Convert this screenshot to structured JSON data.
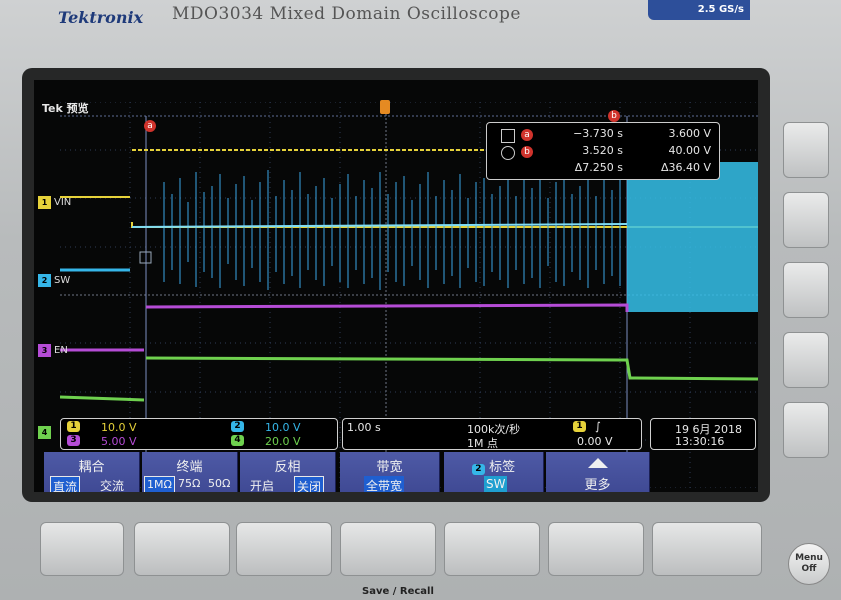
{
  "header": {
    "brand": "Tektronix",
    "model": "MDO3034 Mixed Domain Oscilloscope",
    "spec": "2.5 GS/s"
  },
  "screen": {
    "mode_label": "Tek 预览",
    "channels": [
      {
        "num": "1",
        "label": "VIN",
        "color": "#e6d23a"
      },
      {
        "num": "2",
        "label": "SW",
        "color": "#35b6e8"
      },
      {
        "num": "3",
        "label": "EN",
        "color": "#b54cd6"
      },
      {
        "num": "4",
        "label": "",
        "color": "#6fd14f"
      }
    ],
    "cursor_readout": {
      "a": {
        "symbol": "square",
        "tag": "a",
        "time": "−3.730 s",
        "voltage": "3.600 V"
      },
      "b": {
        "symbol": "circle",
        "tag": "b",
        "time": "3.520 s",
        "voltage": "40.00 V"
      },
      "delta": {
        "time": "Δ7.250 s",
        "voltage": "Δ36.40 V"
      }
    },
    "markers": {
      "a": "a",
      "b": "b"
    }
  },
  "status": {
    "scales": [
      {
        "num": "1",
        "value": "10.0 V",
        "color": "#e6d23a"
      },
      {
        "num": "2",
        "value": "10.0 V",
        "color": "#35b6e8"
      },
      {
        "num": "3",
        "value": "5.00 V",
        "color": "#b54cd6"
      },
      {
        "num": "4",
        "value": "20.0 V",
        "color": "#6fd14f"
      }
    ],
    "timebase": "1.00 s",
    "sample_rate": "100k次/秒",
    "record_length": "1M 点",
    "trigger_channel": "1",
    "trigger_level": "0.00 V",
    "date": "19 6月 2018",
    "time": "13:30:16"
  },
  "menu": {
    "coupling": {
      "title": "耦合",
      "options": [
        "直流",
        "交流"
      ],
      "selected": "直流"
    },
    "termination": {
      "title": "终端",
      "options": [
        "1MΩ",
        "75Ω",
        "50Ω"
      ],
      "selected": "1MΩ"
    },
    "invert": {
      "title": "反相",
      "options": [
        "开启",
        "关闭"
      ],
      "selected": "关闭"
    },
    "bandwidth": {
      "title": "带宽",
      "value": "全带宽"
    },
    "label": {
      "num": "2",
      "title": "标签",
      "value": "SW"
    },
    "more": {
      "title": "更多"
    }
  },
  "front_panel": {
    "menu_off": "Menu Off",
    "save_recall": "Save / Recall"
  }
}
